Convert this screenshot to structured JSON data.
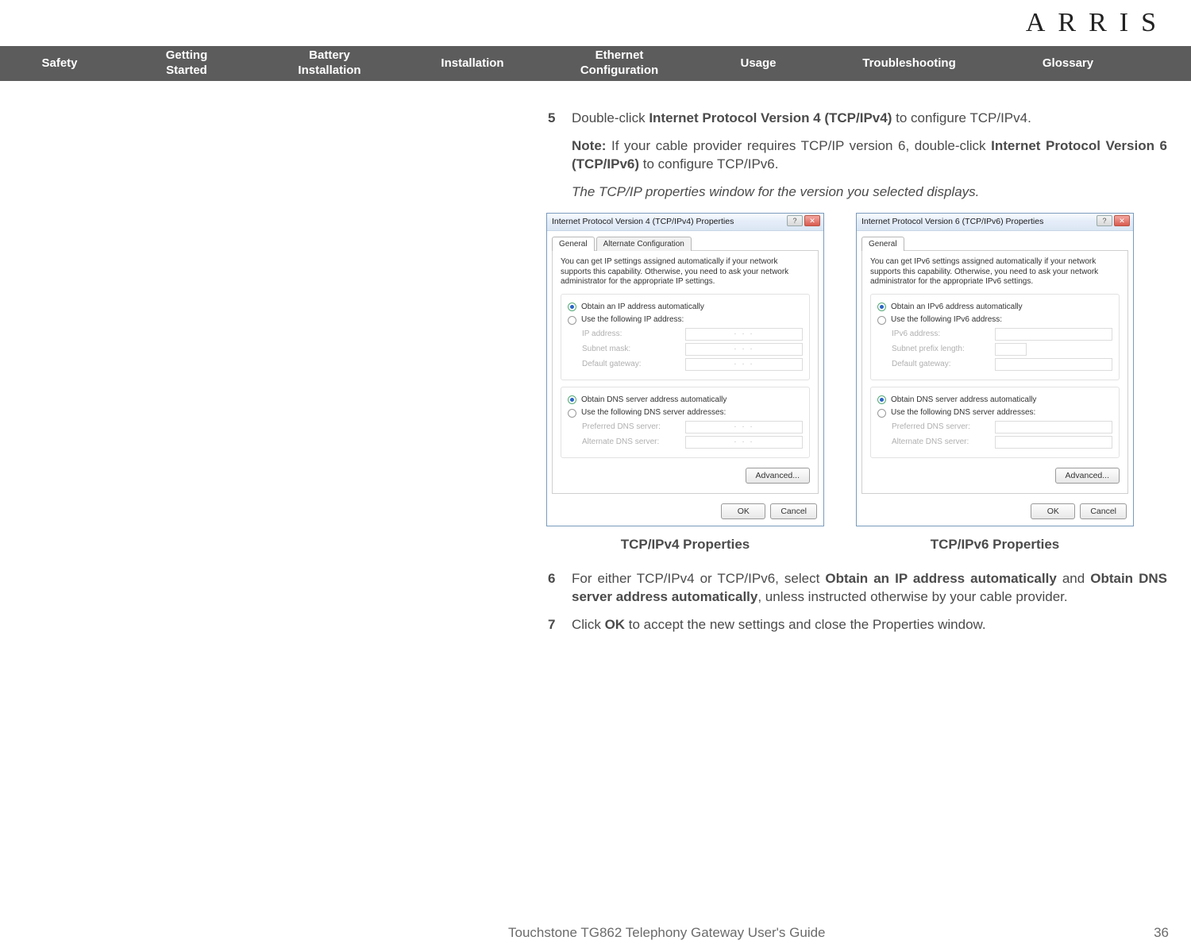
{
  "brand": "ARRIS",
  "nav": {
    "safety": "Safety",
    "getting_started_l1": "Getting",
    "getting_started_l2": "Started",
    "battery_l1": "Battery",
    "battery_l2": "Installation",
    "installation": "Installation",
    "ethernet_l1": "Ethernet",
    "ethernet_l2": "Configuration",
    "usage": "Usage",
    "troubleshooting": "Troubleshooting",
    "glossary": "Glossary"
  },
  "steps": {
    "s5_num": "5",
    "s5_pre": "Double-click ",
    "s5_bold": "Internet Protocol Version 4 (TCP/IPv4)",
    "s5_post": " to configure TCP/IPv4.",
    "note_label": "Note:",
    "note_text1": " If your cable provider requires TCP/IP version 6, double-click ",
    "note_bold": "Internet Protocol Version 6 (TCP/IPv6)",
    "note_text2": " to configure TCP/IPv6.",
    "italic": "The TCP/IP properties window for the version you selected displays.",
    "s6_num": "6",
    "s6_pre": "For either TCP/IPv4 or TCP/IPv6, select ",
    "s6_b1": "Obtain an IP address automatically",
    "s6_mid": " and ",
    "s6_b2": "Obtain DNS server address automatically",
    "s6_post": ", unless instructed otherwise by your cable provider.",
    "s7_num": "7",
    "s7_pre": "Click ",
    "s7_b": "OK",
    "s7_post": " to accept the new settings and close the Properties window."
  },
  "dlg4": {
    "title": "Internet Protocol Version 4 (TCP/IPv4) Properties",
    "tab1": "General",
    "tab2": "Alternate Configuration",
    "desc": "You can get IP settings assigned automatically if your network supports this capability. Otherwise, you need to ask your network administrator for the appropriate IP settings.",
    "r1": "Obtain an IP address automatically",
    "r2": "Use the following IP address:",
    "f_ip": "IP address:",
    "f_mask": "Subnet mask:",
    "f_gw": "Default gateway:",
    "r3": "Obtain DNS server address automatically",
    "r4": "Use the following DNS server addresses:",
    "f_pdns": "Preferred DNS server:",
    "f_adns": "Alternate DNS server:",
    "adv": "Advanced...",
    "ok": "OK",
    "cancel": "Cancel"
  },
  "dlg6": {
    "title": "Internet Protocol Version 6 (TCP/IPv6) Properties",
    "tab1": "General",
    "desc": "You can get IPv6 settings assigned automatically if your network supports this capability. Otherwise, you need to ask your network administrator for the appropriate IPv6 settings.",
    "r1": "Obtain an IPv6 address automatically",
    "r2": "Use the following IPv6 address:",
    "f_ip": "IPv6 address:",
    "f_plen": "Subnet prefix length:",
    "f_gw": "Default gateway:",
    "r3": "Obtain DNS server address automatically",
    "r4": "Use the following DNS server addresses:",
    "f_pdns": "Preferred DNS server:",
    "f_adns": "Alternate DNS server:",
    "adv": "Advanced...",
    "ok": "OK",
    "cancel": "Cancel"
  },
  "captions": {
    "c4": "TCP/IPv4 Properties",
    "c6": "TCP/IPv6 Properties"
  },
  "footer": {
    "title": "Touchstone TG862 Telephony Gateway User's Guide",
    "page": "36"
  }
}
